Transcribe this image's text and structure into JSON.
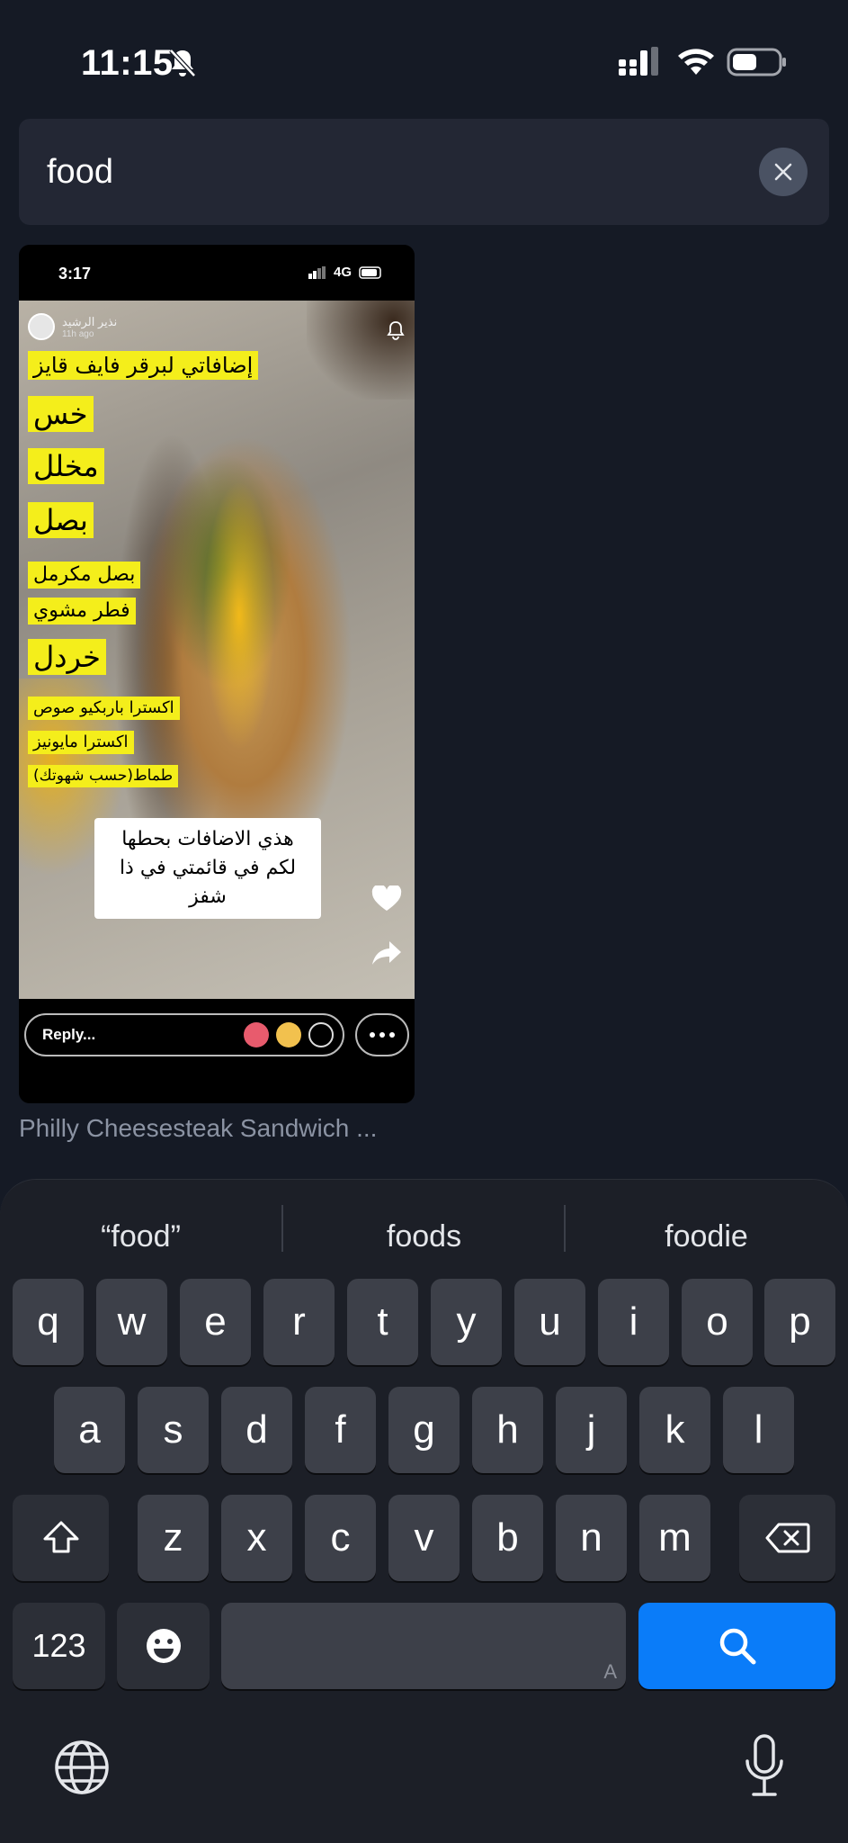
{
  "status_bar": {
    "time": "11:15"
  },
  "search": {
    "value": "food"
  },
  "result": {
    "title": "Philly Cheesesteak Sandwich ...",
    "preview": {
      "status_time": "3:17",
      "network": "4G",
      "username": "نذير الرشيد",
      "posted_ago": "11h ago",
      "labels": [
        "إضافاتي لبرقر فايف قايز",
        "خس",
        "مخلل",
        "بصل",
        "بصل مكرمل",
        "فطر مشوي",
        "خردل",
        "اكسترا باربكيو صوص",
        "اكسترا مايونيز",
        "طماط(حسب شهوتك)"
      ],
      "caption_lines": [
        "هذي الاضافات بحطها",
        "لكم في قائمتي في ذا",
        "شفز"
      ],
      "reply_placeholder": "Reply..."
    }
  },
  "keyboard": {
    "suggestions": [
      "“food”",
      "foods",
      "foodie"
    ],
    "row1": [
      "q",
      "w",
      "e",
      "r",
      "t",
      "y",
      "u",
      "i",
      "o",
      "p"
    ],
    "row2": [
      "a",
      "s",
      "d",
      "f",
      "g",
      "h",
      "j",
      "k",
      "l"
    ],
    "row3": [
      "z",
      "x",
      "c",
      "v",
      "b",
      "n",
      "m"
    ],
    "numbers_key": "123",
    "space_hint": "A",
    "search_key_color": "#0a7cf9"
  }
}
